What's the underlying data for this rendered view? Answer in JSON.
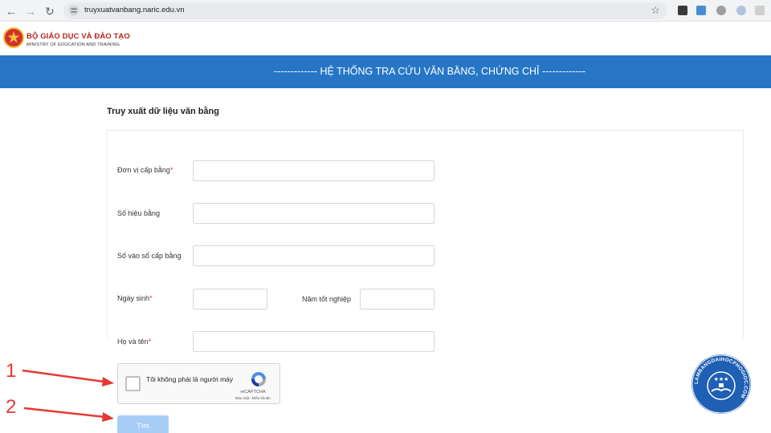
{
  "browser": {
    "url": "truyxuatvanbang.naric.edu.vn"
  },
  "site": {
    "org_name": "BỘ GIÁO DỤC VÀ ĐÀO TẠO",
    "org_name_en": "MINISTRY OF EDUCATION AND TRAINING",
    "banner": "-------------   HỆ THỐNG TRA CỨU VĂN BẰNG, CHỨNG CHỈ   -------------"
  },
  "form": {
    "heading": "Truy xuất dữ liệu văn bằng",
    "issuer_label": "Đơn vị cấp bằng",
    "issuer_value": "",
    "diploma_no_label": "Số hiệu bằng",
    "diploma_no_value": "",
    "register_no_label": "Số vào sổ cấp bằng",
    "register_no_value": "",
    "dob_label": "Ngày sinh",
    "dob_value": "",
    "grad_year_label": "Năm tốt nghiệp",
    "grad_year_value": "",
    "fullname_label": "Họ và tên",
    "fullname_value": "",
    "required_mark": "*",
    "submit_label": "Tìm"
  },
  "captcha": {
    "text": "Tôi không phải là người máy",
    "brand": "reCAPTCHA",
    "terms": "Bảo mật - Điều khoản"
  },
  "annotations": {
    "one": "1",
    "two": "2"
  },
  "watermark": {
    "text": "LAMBANGDAIHOCPHOGIOC.COM"
  },
  "colors": {
    "banner": "#2776c6",
    "required": "#d9342b",
    "annotation": "#e53935",
    "submit_disabled": "#a7cdf6"
  }
}
